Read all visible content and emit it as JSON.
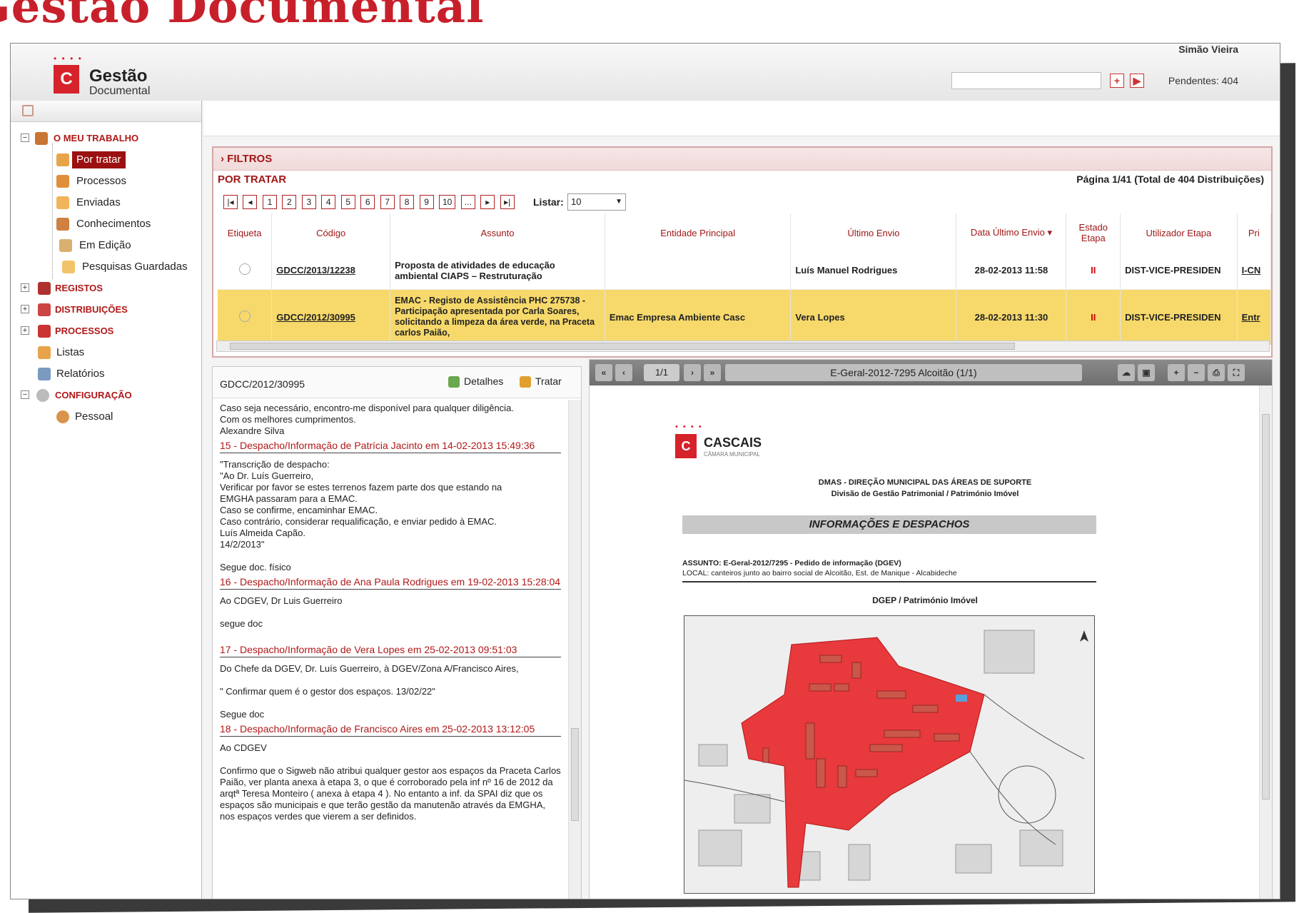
{
  "page_title": "Gestão Documental",
  "app": {
    "logo_letter": "C",
    "logo_main": "Gestão",
    "logo_sub": "Documental",
    "user_name": "Simão Vieira",
    "pending": "Pendentes: 404",
    "add_btn": "+",
    "go_btn": "▶"
  },
  "sidebar": {
    "my_work": "O MEU TRABALHO",
    "items": [
      "Por tratar",
      "Processos",
      "Enviadas",
      "Conhecimentos",
      "Em Edição",
      "Pesquisas Guardadas"
    ],
    "sections": [
      "REGISTOS",
      "DISTRIBUIÇÕES",
      "PROCESSOS"
    ],
    "other": [
      "Listas",
      "Relatórios"
    ],
    "config": "CONFIGURAÇÃO",
    "config_items": [
      "Pessoal"
    ]
  },
  "filters": {
    "label": "› FILTROS",
    "title": "POR TRATAR",
    "page_info": "Página 1/41 (Total de 404 Distribuições)",
    "pages": [
      "1",
      "2",
      "3",
      "4",
      "5",
      "6",
      "7",
      "8",
      "9",
      "10",
      "..."
    ],
    "list_label": "Listar:",
    "list_value": "10"
  },
  "table": {
    "headers": [
      "Etiqueta",
      "Código",
      "Assunto",
      "Entidade Principal",
      "Último Envio",
      "Data Último Envio ▾",
      "Estado Etapa",
      "Utilizador Etapa",
      "Pri"
    ],
    "rows": [
      {
        "codigo": "GDCC/2013/12238",
        "assunto": "Proposta de atividades de educação ambiental CIAPS – Restruturação",
        "entidade": "",
        "envio": "Luís Manuel Rodrigues",
        "data": "28-02-2013 11:58",
        "estado": "II",
        "utilizador": "DIST-VICE-PRESIDEN",
        "pri": "I-CN"
      },
      {
        "codigo": "GDCC/2012/30995",
        "assunto": "EMAC - Registo de Assistência PHC 275738 - Participação apresentada por Carla Soares, solicitando a limpeza da área verde, na Praceta carlos Paião,",
        "entidade": "Emac Empresa Ambiente Casc",
        "envio": "Vera Lopes",
        "data": "28-02-2013 11:30",
        "estado": "II",
        "utilizador": "DIST-VICE-PRESIDEN",
        "pri": "Entr"
      }
    ]
  },
  "detail": {
    "code": "GDCC/2012/30995",
    "details_btn": "Detalhes",
    "treat_btn": "Tratar",
    "intro": [
      "Caso seja necessário, encontro-me disponível para qualquer diligência.",
      "Com os melhores cumprimentos.",
      "Alexandre Silva"
    ],
    "e15_title": "15 - Despacho/Informação de Patrícia Jacinto em 14-02-2013 15:49:36",
    "e15_lines": [
      "\"Transcrição de despacho:",
      "\"Ao Dr. Luís Guerreiro,",
      "Verificar por favor se estes terrenos fazem parte dos que estando na",
      "EMGHA passaram para a EMAC.",
      "Caso se confirme, encaminhar EMAC.",
      "Caso contrário, considerar requalificação, e enviar pedido à EMAC.",
      "Luís Almeida Capão.",
      "14/2/2013\""
    ],
    "e15_after": "Segue doc. físico",
    "e16_title": "16 - Despacho/Informação de Ana Paula Rodrigues em 19-02-2013 15:28:04",
    "e16_to": "Ao CDGEV, Dr Luis Guerreiro",
    "e16_text": "segue doc",
    "e17_title": "17 - Despacho/Informação de Vera Lopes em 25-02-2013 09:51:03",
    "e17_to": "Do Chefe da DGEV, Dr. Luís Guerreiro, à DGEV/Zona A/Francisco Aires,",
    "e17_text": "\" Confirmar quem é o gestor dos espaços. 13/02/22\"",
    "e17_after": "Segue doc",
    "e18_title": "18 - Despacho/Informação de Francisco Aires em 25-02-2013 13:12:05",
    "e18_to": "Ao CDGEV",
    "e18_text": "Confirmo que o Sigweb não atribui qualquer gestor aos espaços da Praceta Carlos Paião, ver planta anexa à etapa 3, o que é corroborado pela inf nº 16 de 2012 da arqtª Teresa Monteiro ( anexa à etapa 4 ). No entanto a inf. da SPAI diz que os espaços são municipais e que terão gestão da manutenão através da EMGHA, nos espaços verdes que vierem a ser definidos."
  },
  "viewer": {
    "page": "1/1",
    "title": "E-Geral-2012-7295 Alcoitão (1/1)",
    "doc_logo_name": "CASCAIS",
    "doc_logo_sub": "CÂMARA MUNICIPAL",
    "doc_line1": "DMAS - DIREÇÃO MUNICIPAL DAS ÁREAS DE SUPORTE",
    "doc_line2": "Divisão de Gestão Patrimonial / Património Imóvel",
    "doc_band": "INFORMAÇÕES E DESPACHOS",
    "doc_subject": "ASSUNTO: E-Geral-2012/7295 - Pedido de informação (DGEV)",
    "doc_local": "LOCAL: canteiros junto ao bairro social de Alcoitão, Est. de Manique - Alcabideche",
    "doc_section": "DGEP / Património Imóvel"
  }
}
